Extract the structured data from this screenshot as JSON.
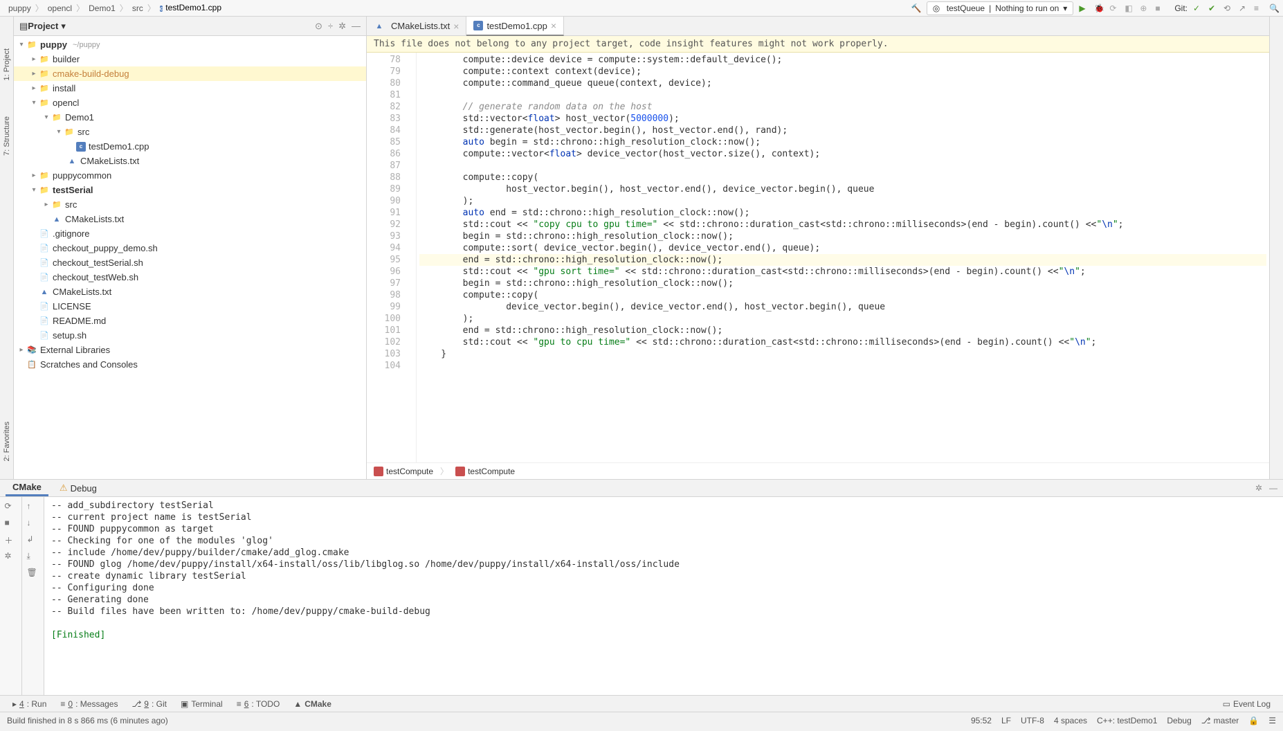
{
  "breadcrumbs": [
    "puppy",
    "opencl",
    "Demo1",
    "src",
    "testDemo1.cpp"
  ],
  "toolbar": {
    "run_config": "testQueue",
    "run_target": "Nothing to run on",
    "git_label": "Git:"
  },
  "side_tabs": {
    "project": "1: Project",
    "structure": "7: Structure",
    "favorites": "2: Favorites"
  },
  "project": {
    "header": "Project",
    "tree": {
      "root": {
        "name": "puppy",
        "hint": "~/puppy"
      },
      "builder": "builder",
      "cmake_build_debug": "cmake-build-debug",
      "install": "install",
      "opencl": "opencl",
      "demo1": "Demo1",
      "src": "src",
      "testdemo": "testDemo1.cpp",
      "cmakelists_demo": "CMakeLists.txt",
      "puppycommon": "puppycommon",
      "testserial": "testSerial",
      "src2": "src",
      "cmakelists_ts": "CMakeLists.txt",
      "gitignore": ".gitignore",
      "checkout_demo": "checkout_puppy_demo.sh",
      "checkout_serial": "checkout_testSerial.sh",
      "checkout_web": "checkout_testWeb.sh",
      "cmakelists_root": "CMakeLists.txt",
      "license": "LICENSE",
      "readme": "README.md",
      "setup": "setup.sh",
      "ext_lib": "External Libraries",
      "scratches": "Scratches and Consoles"
    }
  },
  "editor": {
    "tabs": [
      {
        "name": "CMakeLists.txt",
        "icon": "cmake"
      },
      {
        "name": "testDemo1.cpp",
        "icon": "cpp",
        "active": true
      }
    ],
    "banner": "This file does not belong to any project target, code insight features might not work properly.",
    "gutter_start": 78,
    "code": [
      {
        "n": 78,
        "seg": [
          [
            "p",
            "        compute::device device = compute::system::default_device();"
          ]
        ]
      },
      {
        "n": 79,
        "seg": [
          [
            "p",
            "        compute::context context(device);"
          ]
        ]
      },
      {
        "n": 80,
        "seg": [
          [
            "p",
            "        compute::command_queue queue(context, device);"
          ]
        ]
      },
      {
        "n": 81,
        "seg": [
          [
            "p",
            ""
          ]
        ]
      },
      {
        "n": 82,
        "seg": [
          [
            "cmt",
            "        // generate random data on the host"
          ]
        ]
      },
      {
        "n": 83,
        "seg": [
          [
            "p",
            "        std::vector<"
          ],
          [
            "type",
            "float"
          ],
          [
            "p",
            "> host_vector("
          ],
          [
            "num",
            "5000000"
          ],
          [
            "p",
            ");"
          ]
        ]
      },
      {
        "n": 84,
        "seg": [
          [
            "p",
            "        std::generate(host_vector.begin(), host_vector.end(), rand);"
          ]
        ]
      },
      {
        "n": 85,
        "seg": [
          [
            "p",
            "        "
          ],
          [
            "kw",
            "auto"
          ],
          [
            "p",
            " begin = std::chrono::high_resolution_clock::now();"
          ]
        ]
      },
      {
        "n": 86,
        "seg": [
          [
            "p",
            "        compute::vector<"
          ],
          [
            "type",
            "float"
          ],
          [
            "p",
            "> device_vector(host_vector.size(), context);"
          ]
        ]
      },
      {
        "n": 87,
        "seg": [
          [
            "p",
            ""
          ]
        ]
      },
      {
        "n": 88,
        "seg": [
          [
            "p",
            "        compute::copy("
          ]
        ]
      },
      {
        "n": 89,
        "seg": [
          [
            "p",
            "                host_vector.begin(), host_vector.end(), device_vector.begin(), queue"
          ]
        ]
      },
      {
        "n": 90,
        "seg": [
          [
            "p",
            "        );"
          ]
        ]
      },
      {
        "n": 91,
        "seg": [
          [
            "p",
            "        "
          ],
          [
            "kw",
            "auto"
          ],
          [
            "p",
            " end = std::chrono::high_resolution_clock::now();"
          ]
        ]
      },
      {
        "n": 92,
        "seg": [
          [
            "p",
            "        std::cout << "
          ],
          [
            "str",
            "\"copy cpu to gpu time=\""
          ],
          [
            "p",
            " << std::chrono::duration_cast<std::chrono::milliseconds>(end - begin).count() <<"
          ],
          [
            "str",
            "\""
          ],
          [
            "esc",
            "\\n"
          ],
          [
            "str",
            "\""
          ],
          [
            "p",
            ";"
          ]
        ]
      },
      {
        "n": 93,
        "seg": [
          [
            "p",
            "        begin = std::chrono::high_resolution_clock::now();"
          ]
        ]
      },
      {
        "n": 94,
        "seg": [
          [
            "p",
            "        compute::sort( device_vector.begin(), device_vector.end(), queue);"
          ]
        ]
      },
      {
        "n": 95,
        "hl": true,
        "seg": [
          [
            "p",
            "        end = std::chrono::high_resolution_clock::now();"
          ]
        ]
      },
      {
        "n": 96,
        "seg": [
          [
            "p",
            "        std::cout << "
          ],
          [
            "str",
            "\"gpu sort time=\""
          ],
          [
            "p",
            " << std::chrono::duration_cast<std::chrono::milliseconds>(end - begin).count() <<"
          ],
          [
            "str",
            "\""
          ],
          [
            "esc",
            "\\n"
          ],
          [
            "str",
            "\""
          ],
          [
            "p",
            ";"
          ]
        ]
      },
      {
        "n": 97,
        "seg": [
          [
            "p",
            "        begin = std::chrono::high_resolution_clock::now();"
          ]
        ]
      },
      {
        "n": 98,
        "seg": [
          [
            "p",
            "        compute::copy("
          ]
        ]
      },
      {
        "n": 99,
        "seg": [
          [
            "p",
            "                device_vector.begin(), device_vector.end(), host_vector.begin(), queue"
          ]
        ]
      },
      {
        "n": 100,
        "seg": [
          [
            "p",
            "        );"
          ]
        ]
      },
      {
        "n": 101,
        "seg": [
          [
            "p",
            "        end = std::chrono::high_resolution_clock::now();"
          ]
        ]
      },
      {
        "n": 102,
        "seg": [
          [
            "p",
            "        std::cout << "
          ],
          [
            "str",
            "\"gpu to cpu time=\""
          ],
          [
            "p",
            " << std::chrono::duration_cast<std::chrono::milliseconds>(end - begin).count() <<"
          ],
          [
            "str",
            "\""
          ],
          [
            "esc",
            "\\n"
          ],
          [
            "str",
            "\""
          ],
          [
            "p",
            ";"
          ]
        ]
      },
      {
        "n": 103,
        "seg": [
          [
            "p",
            "    }"
          ]
        ]
      },
      {
        "n": 104,
        "seg": [
          [
            "p",
            ""
          ]
        ]
      }
    ],
    "crumbs": [
      "testCompute",
      "testCompute"
    ]
  },
  "bottom": {
    "cmake_tab": "CMake",
    "debug_tab": "Debug",
    "output": [
      "-- add_subdirectory testSerial",
      "-- current project name is testSerial",
      "-- FOUND puppycommon as target",
      "-- Checking for one of the modules 'glog'",
      "-- include /home/dev/puppy/builder/cmake/add_glog.cmake",
      "-- FOUND glog /home/dev/puppy/install/x64-install/oss/lib/libglog.so /home/dev/puppy/install/x64-install/oss/include",
      "-- create dynamic library testSerial",
      "-- Configuring done",
      "-- Generating done",
      "-- Build files have been written to: /home/dev/puppy/cmake-build-debug",
      "",
      "[Finished]"
    ]
  },
  "footer": {
    "run": "4: Run",
    "messages": "0: Messages",
    "git": "9: Git",
    "terminal": "Terminal",
    "todo": "6: TODO",
    "cmake": "CMake",
    "eventlog": "Event Log"
  },
  "status": {
    "msg": "Build finished in 8 s 866 ms (6 minutes ago)",
    "pos": "95:52",
    "enc": "LF",
    "encoding": "UTF-8",
    "indent": "4 spaces",
    "lang": "C++: testDemo1",
    "config": "Debug",
    "branch": "master"
  }
}
